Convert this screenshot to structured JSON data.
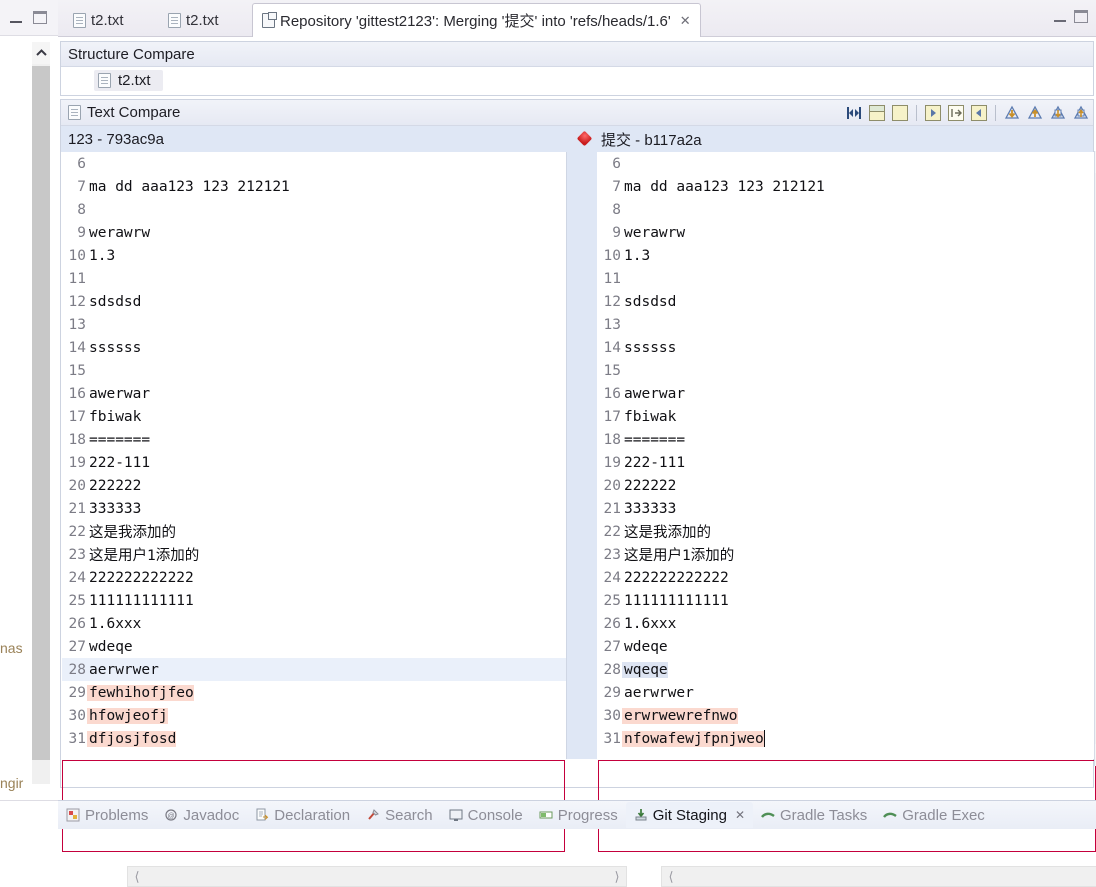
{
  "background_window": {
    "fragments": [
      "nas",
      "ngir"
    ],
    "scroll_up_icon": "chevron-up-icon"
  },
  "window": {
    "minimize_label": "—",
    "maximize_label": "□"
  },
  "tabs": [
    {
      "label": "t2.txt",
      "icon": "file-icon",
      "active": false,
      "closable": false
    },
    {
      "label": "t2.txt",
      "icon": "file-icon",
      "active": false,
      "closable": false
    },
    {
      "label": "Repository 'gittest2123': Merging '提交' into 'refs/heads/1.6'",
      "icon": "repository-icon",
      "active": true,
      "closable": true,
      "close_label": "✕"
    }
  ],
  "structure_compare": {
    "title": "Structure Compare",
    "item": {
      "label": "t2.txt",
      "icon": "file-icon"
    }
  },
  "text_compare": {
    "title": "Text Compare",
    "title_icon": "file-icon",
    "toolbar": [
      {
        "name": "switch-compare-viewer-icon"
      },
      {
        "name": "two-pane-layout-icon"
      },
      {
        "name": "synchronize-scrolling-icon"
      },
      {
        "name": "separator"
      },
      {
        "name": "copy-all-left-to-right-icon"
      },
      {
        "name": "copy-current-change-icon"
      },
      {
        "name": "copy-all-right-to-left-icon"
      },
      {
        "name": "separator"
      },
      {
        "name": "next-difference-icon"
      },
      {
        "name": "previous-difference-icon"
      },
      {
        "name": "next-change-icon"
      },
      {
        "name": "previous-change-icon"
      }
    ],
    "left_header": "123 - 793ac9a",
    "right_header": "提交 - b117a2a",
    "diff_marker_icon": "diff-diamond-icon"
  },
  "left_editor": {
    "lines": [
      {
        "num": "6",
        "text": "",
        "style": ""
      },
      {
        "num": "7",
        "text": "ma dd aaa123 123 212121",
        "style": ""
      },
      {
        "num": "8",
        "text": "",
        "style": ""
      },
      {
        "num": "9",
        "text": "werawrw",
        "style": ""
      },
      {
        "num": "10",
        "text": "1.3",
        "style": ""
      },
      {
        "num": "11",
        "text": "",
        "style": ""
      },
      {
        "num": "12",
        "text": "sdsdsd",
        "style": ""
      },
      {
        "num": "13",
        "text": "",
        "style": ""
      },
      {
        "num": "14",
        "text": "ssssss",
        "style": ""
      },
      {
        "num": "15",
        "text": "",
        "style": ""
      },
      {
        "num": "16",
        "text": "awerwar",
        "style": ""
      },
      {
        "num": "17",
        "text": "fbiwak",
        "style": ""
      },
      {
        "num": "18",
        "text": "=======",
        "style": ""
      },
      {
        "num": "19",
        "text": "222-111",
        "style": ""
      },
      {
        "num": "20",
        "text": "222222",
        "style": ""
      },
      {
        "num": "21",
        "text": "333333",
        "style": ""
      },
      {
        "num": "22",
        "text": "这是我添加的",
        "style": ""
      },
      {
        "num": "23",
        "text": "这是用户1添加的",
        "style": ""
      },
      {
        "num": "24",
        "text": "222222222222",
        "style": ""
      },
      {
        "num": "25",
        "text": "111111111111",
        "style": ""
      },
      {
        "num": "26",
        "text": "1.6xxx",
        "style": ""
      },
      {
        "num": "27",
        "text": "wdeqe",
        "style": ""
      },
      {
        "num": "28",
        "text": "aerwrwer",
        "style": "row-blue"
      },
      {
        "num": "29",
        "text": "fewhihofjfeo",
        "style": "hl-pink"
      },
      {
        "num": "30",
        "text": "hfowjeofj",
        "style": "hl-pink"
      },
      {
        "num": "31",
        "text": "dfjosjfosd",
        "style": "hl-pink"
      }
    ]
  },
  "right_editor": {
    "lines": [
      {
        "num": "6",
        "text": "",
        "style": ""
      },
      {
        "num": "7",
        "text": "ma dd aaa123 123 212121",
        "style": ""
      },
      {
        "num": "8",
        "text": "",
        "style": ""
      },
      {
        "num": "9",
        "text": "werawrw",
        "style": ""
      },
      {
        "num": "10",
        "text": "1.3",
        "style": ""
      },
      {
        "num": "11",
        "text": "",
        "style": ""
      },
      {
        "num": "12",
        "text": "sdsdsd",
        "style": ""
      },
      {
        "num": "13",
        "text": "",
        "style": ""
      },
      {
        "num": "14",
        "text": "ssssss",
        "style": ""
      },
      {
        "num": "15",
        "text": "",
        "style": ""
      },
      {
        "num": "16",
        "text": "awerwar",
        "style": ""
      },
      {
        "num": "17",
        "text": "fbiwak",
        "style": ""
      },
      {
        "num": "18",
        "text": "=======",
        "style": ""
      },
      {
        "num": "19",
        "text": "222-111",
        "style": ""
      },
      {
        "num": "20",
        "text": "222222",
        "style": ""
      },
      {
        "num": "21",
        "text": "333333",
        "style": ""
      },
      {
        "num": "22",
        "text": "这是我添加的",
        "style": ""
      },
      {
        "num": "23",
        "text": "这是用户1添加的",
        "style": ""
      },
      {
        "num": "24",
        "text": "222222222222",
        "style": ""
      },
      {
        "num": "25",
        "text": "111111111111",
        "style": ""
      },
      {
        "num": "26",
        "text": "1.6xxx",
        "style": ""
      },
      {
        "num": "27",
        "text": "wdeqe",
        "style": ""
      },
      {
        "num": "28",
        "text": "wqeqe",
        "style": "hl-blue"
      },
      {
        "num": "29",
        "text": "aerwrwer",
        "style": ""
      },
      {
        "num": "30",
        "text": "erwrwewrefnwo",
        "style": "hl-pink"
      },
      {
        "num": "31",
        "text": "nfowafewjfpnjweo",
        "style": "hl-pink",
        "caret": true
      }
    ]
  },
  "colors": {
    "diff_outline": "#c4003c",
    "changed_text_bg": "#fbd9cf",
    "selected_text_bg": "#dde4f2",
    "header_bg": "#dfe7f5",
    "ruler_marker": "#e02020"
  },
  "scrollbars": {
    "vertical_up_icon": "chevron-up-icon",
    "vertical_down_icon": "chevron-down-icon",
    "horizontal_left_icon": "chevron-left-icon",
    "horizontal_right_icon": "chevron-right-icon"
  },
  "bottom_tabs": [
    {
      "label": "Problems",
      "icon": "problems-icon",
      "active": false
    },
    {
      "label": "Javadoc",
      "icon": "javadoc-icon",
      "active": false
    },
    {
      "label": "Declaration",
      "icon": "declaration-icon",
      "active": false
    },
    {
      "label": "Search",
      "icon": "search-icon",
      "active": false
    },
    {
      "label": "Console",
      "icon": "console-icon",
      "active": false
    },
    {
      "label": "Progress",
      "icon": "progress-icon",
      "active": false
    },
    {
      "label": "Git Staging",
      "icon": "git-staging-icon",
      "active": true,
      "close_label": "✕"
    },
    {
      "label": "Gradle Tasks",
      "icon": "gradle-icon",
      "active": false
    },
    {
      "label": "Gradle Exec",
      "icon": "gradle-icon",
      "active": false
    }
  ]
}
